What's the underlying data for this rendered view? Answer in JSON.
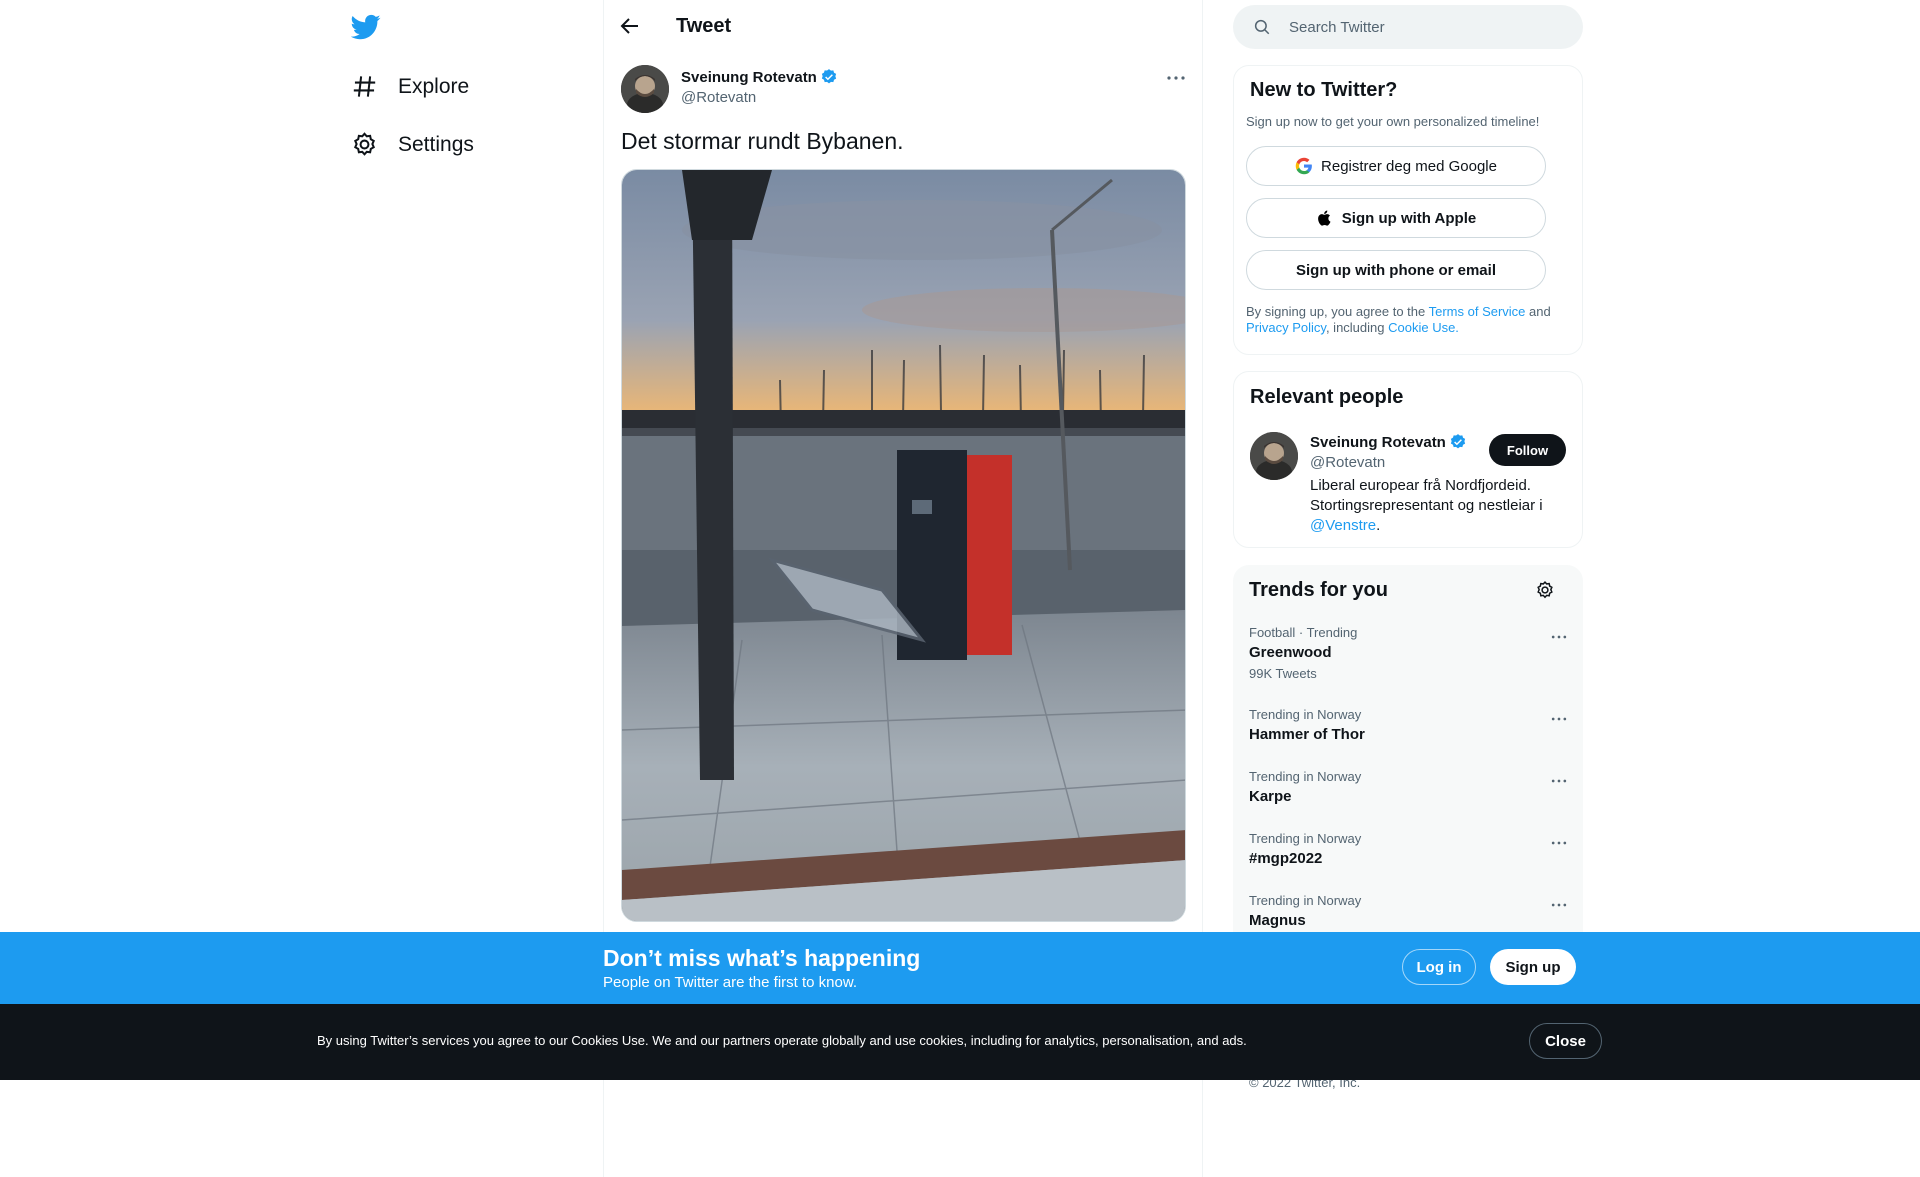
{
  "colors": {
    "accent": "#1d9bf0",
    "text": "#0f1419",
    "muted": "#536471"
  },
  "nav": {
    "logo_icon": "twitter-bird-icon",
    "items": [
      {
        "label": "Explore",
        "icon": "hashtag-icon"
      },
      {
        "label": "Settings",
        "icon": "gear-icon"
      }
    ]
  },
  "tweet": {
    "header_title": "Tweet",
    "author_name": "Sveinung Rotevatn",
    "author_handle": "@Rotevatn",
    "text": "Det stormar rundt Bybanen."
  },
  "search": {
    "placeholder": "Search Twitter"
  },
  "signup": {
    "title": "New to Twitter?",
    "subtitle": "Sign up now to get your own personalized timeline!",
    "google": "Registrer deg med Google",
    "apple": "Sign up with Apple",
    "email": "Sign up with phone or email",
    "legal_1": "By signing up, you agree to the ",
    "terms": "Terms of Service",
    "legal_2": " and ",
    "privacy": "Privacy Policy",
    "legal_3": ", including ",
    "cookie": "Cookie Use."
  },
  "relevant": {
    "title": "Relevant people",
    "name": "Sveinung Rotevatn",
    "handle": "@Rotevatn",
    "follow": "Follow",
    "bio": "Liberal europear frå Nordfjordeid. Stortingsrepresentant og nestleiar i ",
    "bio_link": "@Venstre",
    "bio_end": "."
  },
  "trends": {
    "title": "Trends for you",
    "items": [
      {
        "meta": "Football · Trending",
        "name": "Greenwood",
        "count": "99K Tweets"
      },
      {
        "meta": "Trending in Norway",
        "name": "Hammer of Thor"
      },
      {
        "meta": "Trending in Norway",
        "name": "Karpe"
      },
      {
        "meta": "Trending in Norway",
        "name": "#mgp2022"
      },
      {
        "meta": "Trending in Norway",
        "name": "Magnus"
      }
    ]
  },
  "copyright": "© 2022 Twitter, Inc.",
  "banner": {
    "title": "Don’t miss what’s happening",
    "subtitle": "People on Twitter are the first to know.",
    "login": "Log in",
    "signup": "Sign up"
  },
  "cookie_bar": {
    "text": "By using Twitter’s services you agree to our Cookies Use. We and our partners operate globally and use cookies, including for analytics, personalisation, and ads.",
    "close": "Close"
  }
}
